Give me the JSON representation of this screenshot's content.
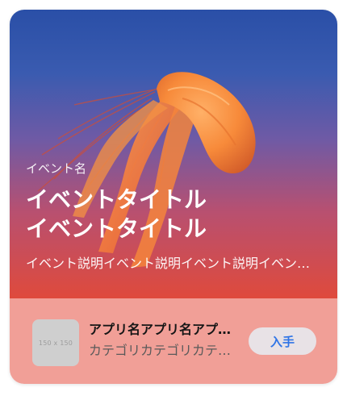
{
  "event": {
    "subtitle": "イベント名",
    "title_line1": "イベントタイトル",
    "title_line2": "イベントタイトル",
    "description": "イベント説明イベント説明イベント説明イベント説明"
  },
  "app": {
    "icon_placeholder": "150 x 150",
    "name": "アプリ名アプリ名アプリ名",
    "category": "カテゴリカテゴリカテゴリ",
    "get_label": "入手"
  },
  "colors": {
    "footer_background": "#f19f97",
    "get_button_background": "#e8e2e6",
    "get_button_text": "#2f74e6"
  }
}
